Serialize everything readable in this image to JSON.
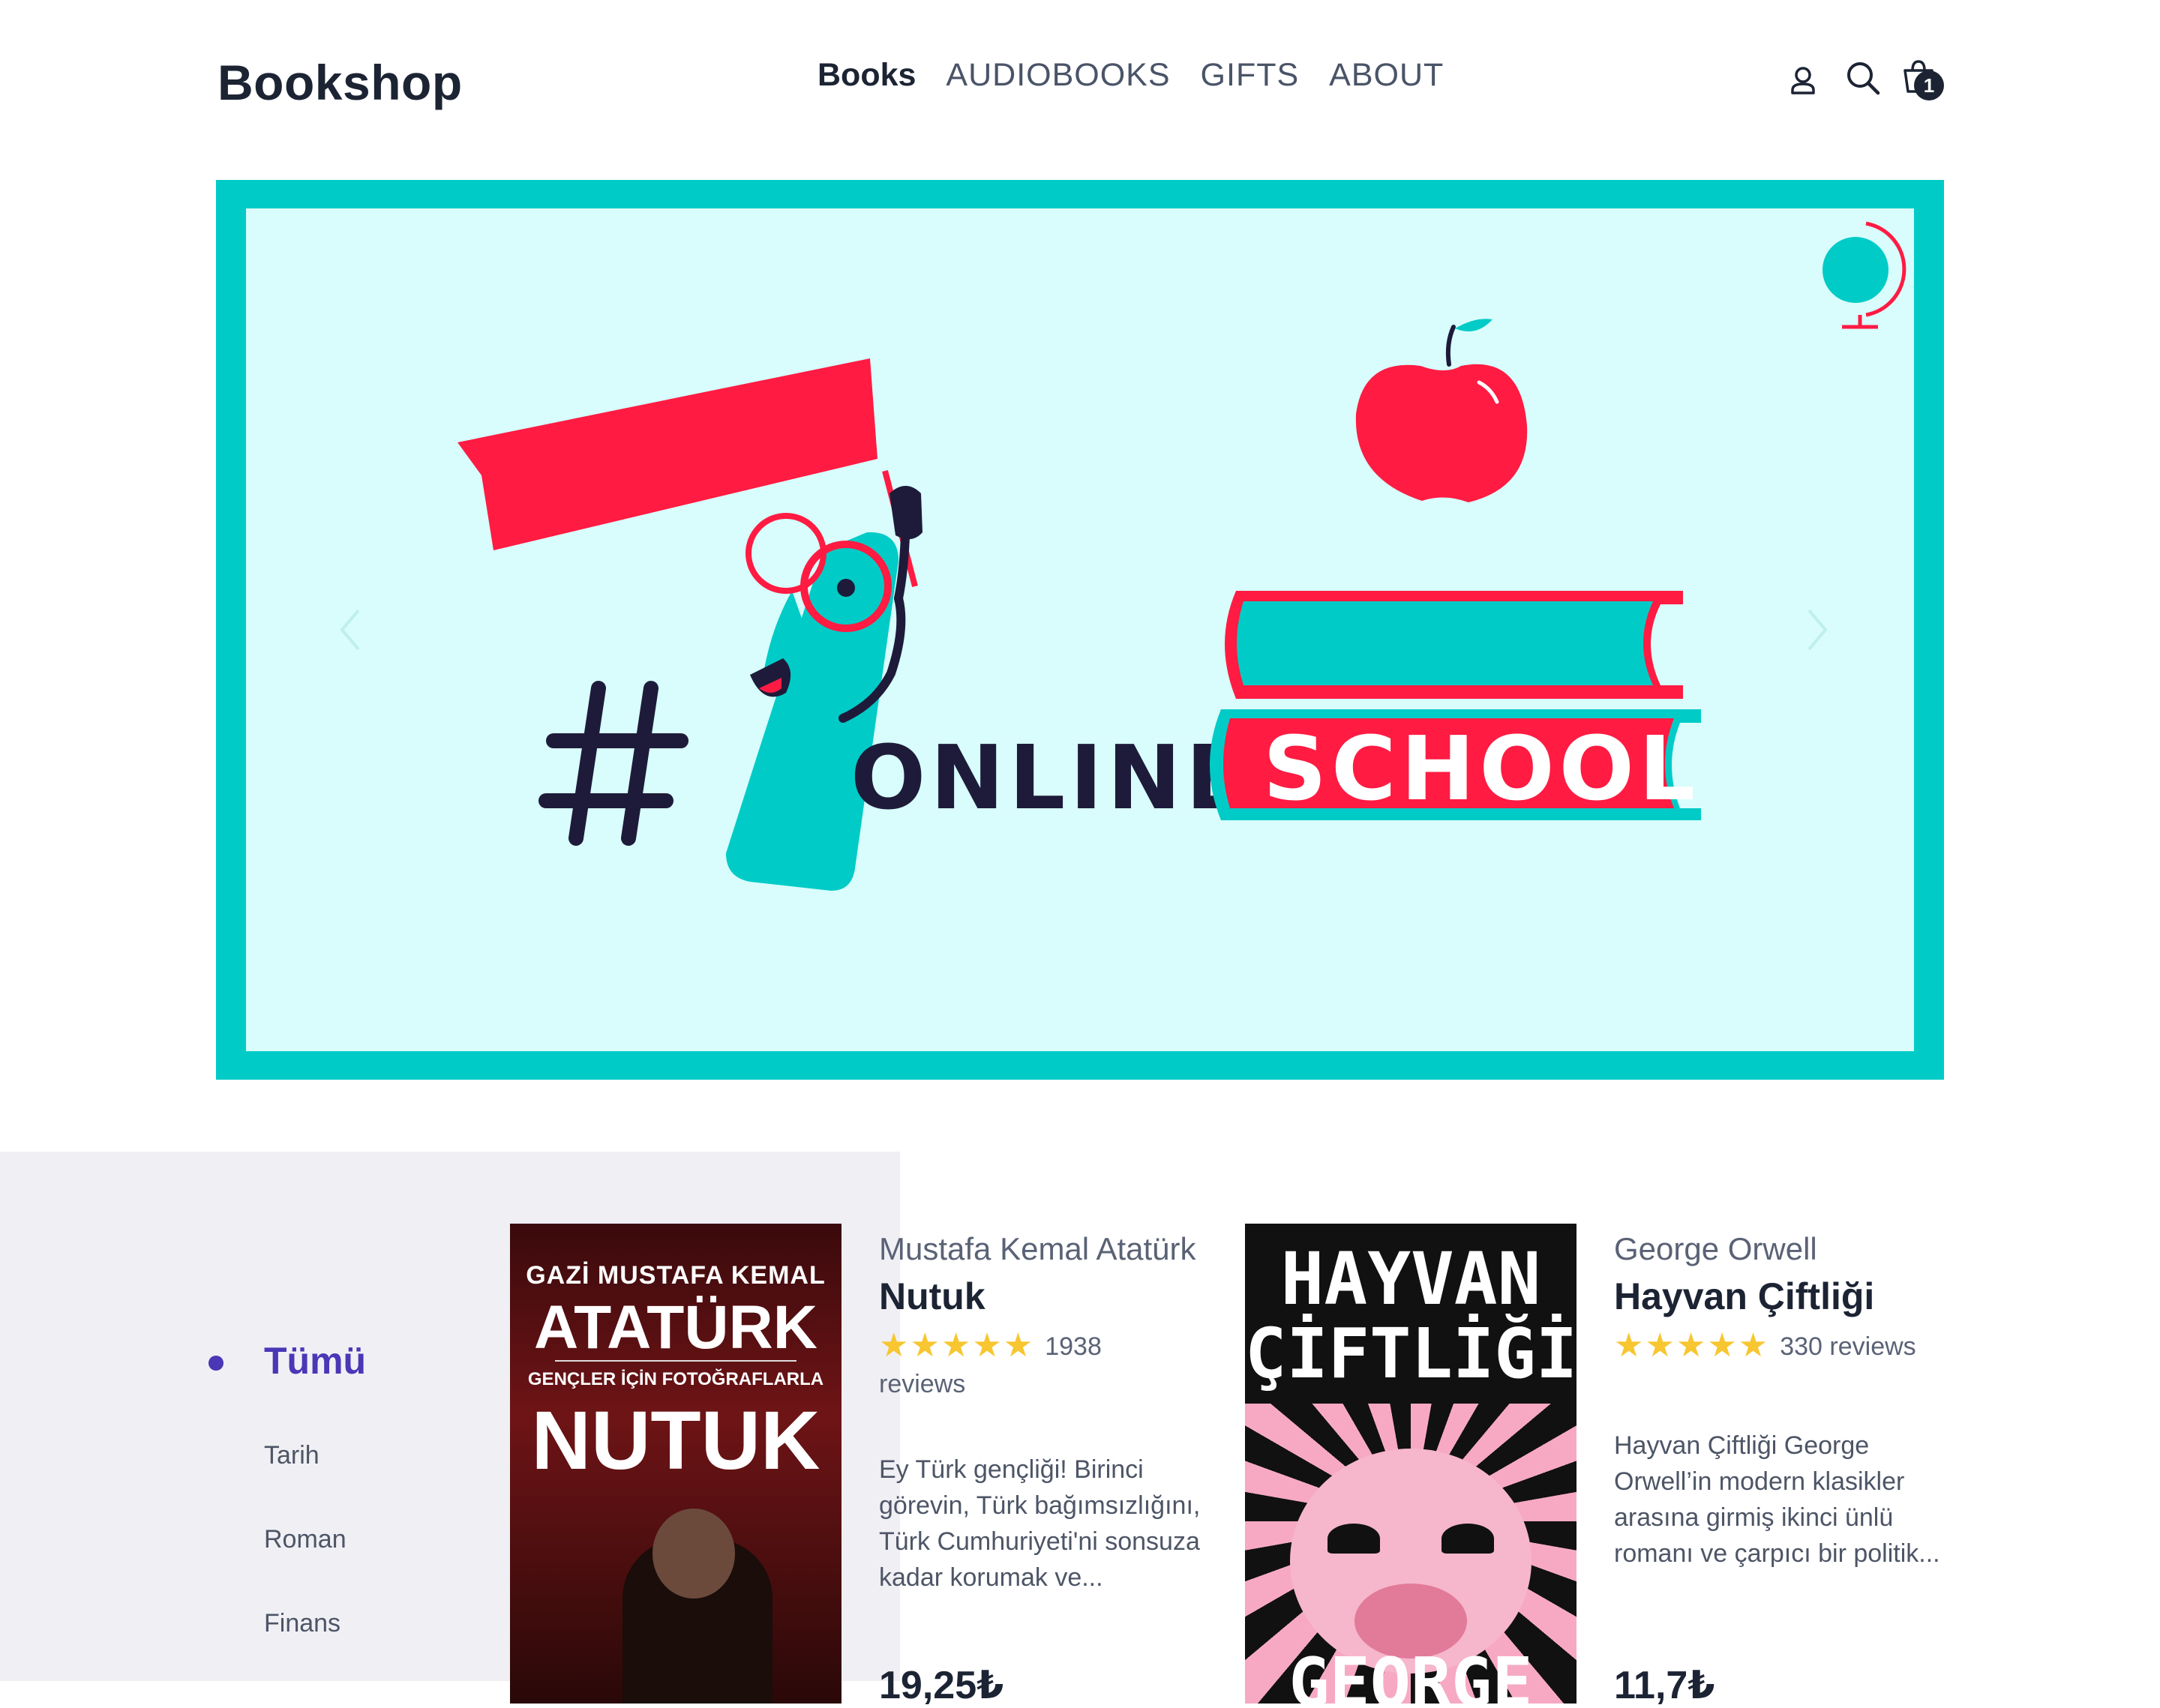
{
  "header": {
    "logo": "Bookshop",
    "nav": [
      "Books",
      "AUDIOBOOKS",
      "GIFTS",
      "ABOUT"
    ],
    "icons": [
      "user-icon",
      "search-icon",
      "cart-icon"
    ],
    "cart_count": "1"
  },
  "hero": {
    "text_online": "ONLINE",
    "text_school": "SCHOOL",
    "text_number": "#1",
    "colors": {
      "frame": "#00cbc7",
      "background": "#d8fdfc",
      "red": "#ff1b42",
      "navy": "#1e1b3a"
    }
  },
  "categories": {
    "items": [
      "Tümü",
      "Tarih",
      "Roman",
      "Finans"
    ],
    "active": "Tümü"
  },
  "books": [
    {
      "author": "Mustafa Kemal Atatürk",
      "title": "Nutuk",
      "stars": "★★★★★",
      "reviews_count": "1938",
      "reviews_word": "reviews",
      "description": "Ey Türk gençliği! Birinci görevin, Türk bağımsızlığını, Türk Cumhuriyeti'ni sonsuza kadar korumak ve...",
      "price": "19,25₺",
      "cover": {
        "line1": "GAZİ MUSTAFA KEMAL",
        "line2": "ATATÜRK",
        "line3": "GENÇLER İÇİN FOTOĞRAFLARLA",
        "line4": "NUTUK"
      }
    },
    {
      "author": "George Orwell",
      "title": "Hayvan Çiftliği",
      "stars": "★★★★★",
      "reviews_count": "330",
      "reviews_word": "reviews",
      "description": "Hayvan Çiftliği George Orwell’in modern klasikler arasına girmiş ikinci ünlü romanı ve çarpıcı bir politik...",
      "price": "11,7₺",
      "cover": {
        "line1": "HAYVAN",
        "line2": "ÇİFTLİĞİ",
        "line3": "GEORGE"
      }
    }
  ]
}
